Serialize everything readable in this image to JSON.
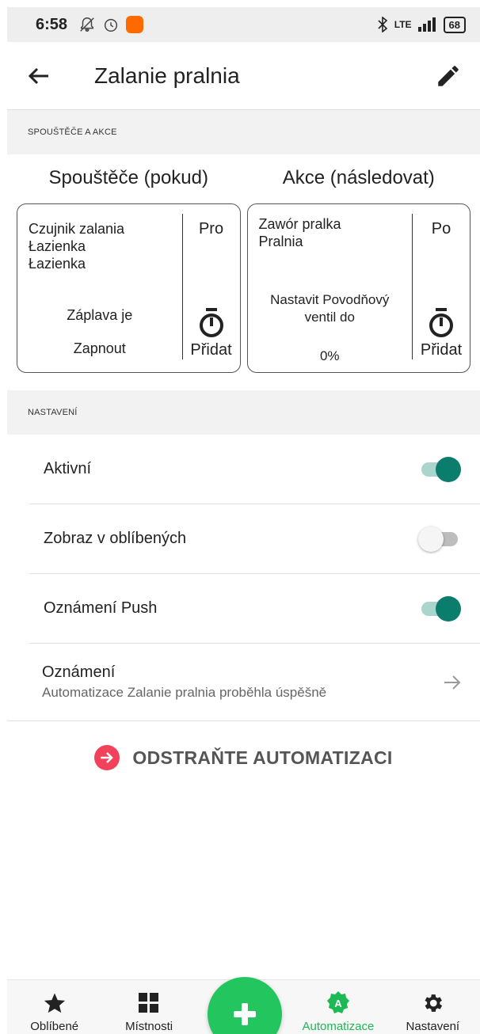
{
  "statusbar": {
    "time": "6:58",
    "network": "LTE",
    "battery": "68"
  },
  "appbar": {
    "title": "Zalanie pralnia"
  },
  "rules_section": {
    "header": "SPOUŠTĚČE A AKCE",
    "triggers": {
      "title": "Spouštěče (pokud)",
      "device": "Czujnik zalania\nŁazienka\nŁazienka",
      "condition": "Záplava je",
      "state": "Zapnout",
      "side_label": "Pro",
      "add_label": "Přidat"
    },
    "actions": {
      "title": "Akce (následovat)",
      "device": "Zawór pralka\nPralnia",
      "description": "Nastavit Povodňový ventil do",
      "value": "0%",
      "side_label": "Po",
      "add_label": "Přidat"
    }
  },
  "settings_section": {
    "header": "NASTAVENÍ",
    "items": [
      {
        "label": "Aktivní",
        "on": true
      },
      {
        "label": "Zobraz v oblíbených",
        "on": false
      },
      {
        "label": "Oznámení Push",
        "on": true
      }
    ],
    "notification": {
      "title": "Oznámení",
      "subtitle": "Automatizace Zalanie pralnia proběhla úspěšně"
    },
    "delete_label": "ODSTRAŇTE AUTOMATIZACI"
  },
  "bottomnav": {
    "items": [
      {
        "label": "Oblíbené",
        "icon": "star-icon"
      },
      {
        "label": "Místnosti",
        "icon": "grid-icon"
      },
      {
        "label": "Automatizace",
        "icon": "automation-icon",
        "active": true
      },
      {
        "label": "Nastavení",
        "icon": "gear-icon"
      }
    ],
    "fab_icon": "plus-icon"
  },
  "colors": {
    "accent_green": "#22c55e",
    "toggle_on": "#0b7d6c",
    "delete_red": "#f2415a"
  }
}
